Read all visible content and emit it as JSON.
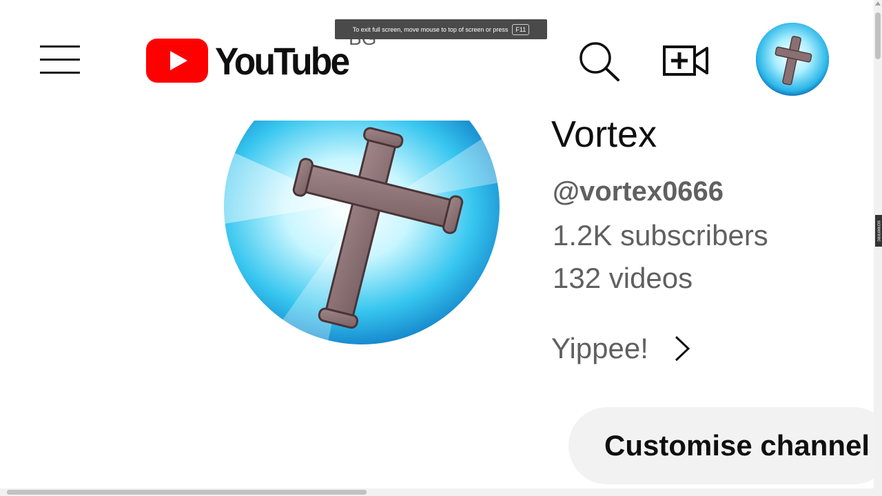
{
  "header": {
    "logo_text": "YouTube",
    "country_code": "BG",
    "icons": [
      "menu-icon",
      "youtube-play-icon",
      "search-icon",
      "create-video-icon",
      "account-avatar"
    ]
  },
  "fullscreen_toast": {
    "message": "To exit full screen, move mouse to top of screen or press",
    "key": "F11"
  },
  "channel": {
    "name": "Vortex",
    "handle": "@vortex0666",
    "subscribers": "1.2K subscribers",
    "videos": "132 videos",
    "description": "Yippee!",
    "customise_label": "Customise channel"
  },
  "watermark": "screenrec",
  "colors": {
    "youtube_red": "#ff0000",
    "secondary_text": "#606060",
    "button_bg": "#f2f2f2"
  }
}
